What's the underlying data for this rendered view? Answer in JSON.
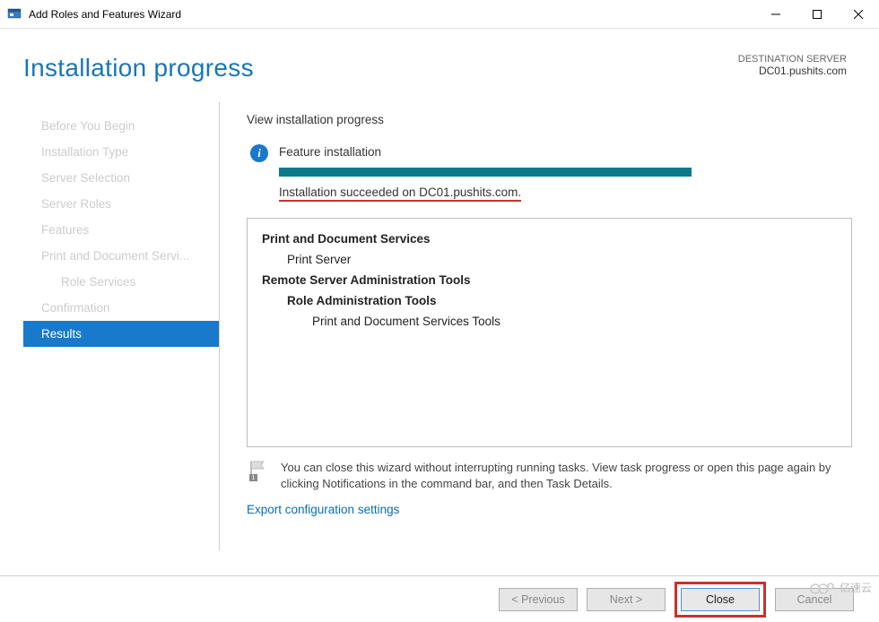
{
  "window": {
    "title": "Add Roles and Features Wizard"
  },
  "header": {
    "page_title": "Installation progress",
    "dest_label": "DESTINATION SERVER",
    "dest_server": "DC01.pushits.com"
  },
  "sidebar": {
    "items": [
      {
        "label": "Before You Begin",
        "active": false
      },
      {
        "label": "Installation Type",
        "active": false
      },
      {
        "label": "Server Selection",
        "active": false
      },
      {
        "label": "Server Roles",
        "active": false
      },
      {
        "label": "Features",
        "active": false
      },
      {
        "label": "Print and Document Servi...",
        "active": false
      },
      {
        "label": "Role Services",
        "active": false,
        "sub": true
      },
      {
        "label": "Confirmation",
        "active": false
      },
      {
        "label": "Results",
        "active": true
      }
    ]
  },
  "main": {
    "view_heading": "View installation progress",
    "status_title": "Feature installation",
    "succeed_text": "Installation succeeded on DC01.pushits.com.",
    "results": {
      "group1": "Print and Document Services",
      "group1_item1": "Print Server",
      "group2": "Remote Server Administration Tools",
      "group2_item1": "Role Administration Tools",
      "group2_item1_sub": "Print and Document Services Tools"
    },
    "note": "You can close this wizard without interrupting running tasks. View task progress or open this page again by clicking Notifications in the command bar, and then Task Details.",
    "export_link": "Export configuration settings"
  },
  "buttons": {
    "previous": "< Previous",
    "next": "Next >",
    "close": "Close",
    "cancel": "Cancel"
  },
  "watermark": "亿速云"
}
